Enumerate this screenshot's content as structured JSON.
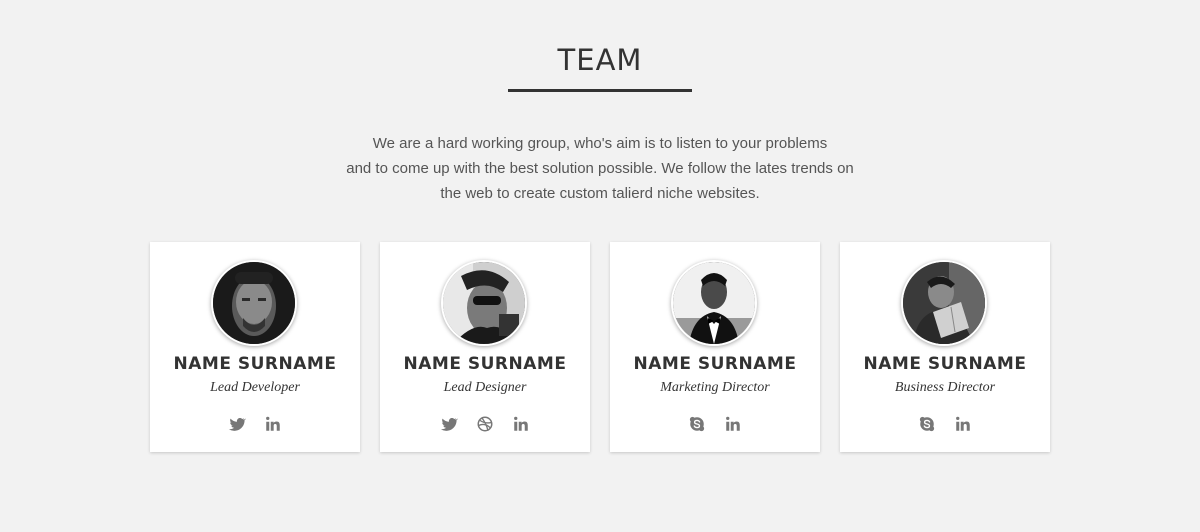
{
  "section": {
    "title": "TEAM",
    "intro_lines": [
      "We are a hard working group, who's aim is to listen to your problems",
      "and to come up with the best solution possible. We follow the lates trends on",
      "the web to create custom talierd niche websites."
    ]
  },
  "colors": {
    "background": "#f2f2f2",
    "card": "#ffffff",
    "text": "#333333",
    "icon": "#777777"
  },
  "team": [
    {
      "name": "NAME SURNAME",
      "role": "Lead Developer",
      "avatar": "avatar-photo-man-beard",
      "social": [
        "twitter-icon",
        "linkedin-icon"
      ]
    },
    {
      "name": "NAME SURNAME",
      "role": "Lead Designer",
      "avatar": "avatar-photo-man-sunglasses",
      "social": [
        "twitter-icon",
        "dribbble-icon",
        "linkedin-icon"
      ]
    },
    {
      "name": "NAME SURNAME",
      "role": "Marketing Director",
      "avatar": "avatar-photo-man-bowtie",
      "social": [
        "skype-icon",
        "linkedin-icon"
      ]
    },
    {
      "name": "NAME SURNAME",
      "role": "Business Director",
      "avatar": "avatar-photo-man-reading",
      "social": [
        "skype-icon",
        "linkedin-icon"
      ]
    }
  ]
}
